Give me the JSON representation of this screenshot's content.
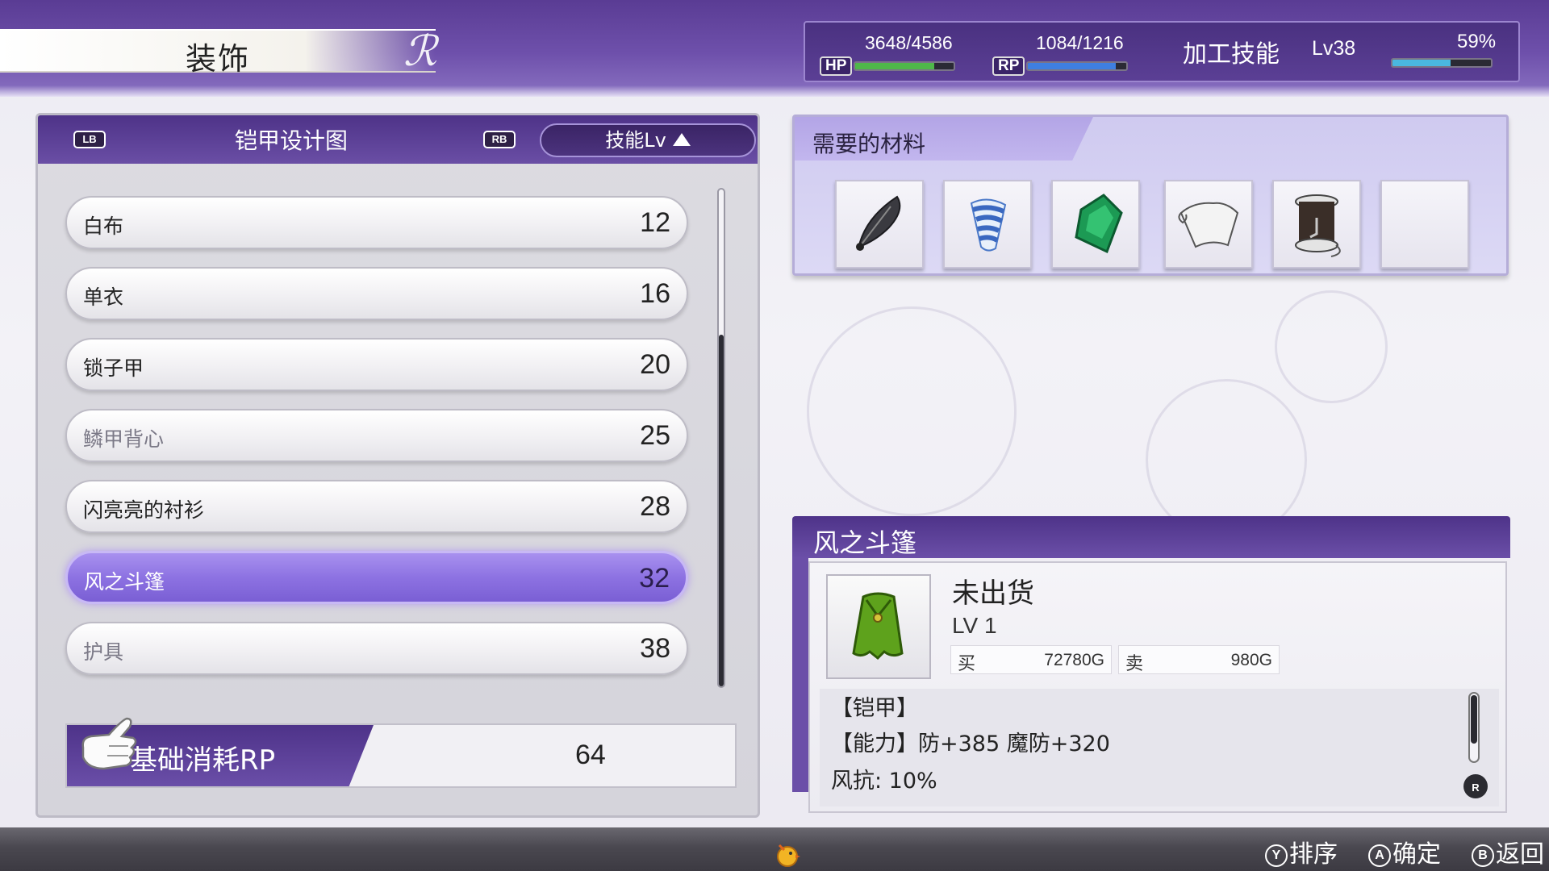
{
  "header": {
    "title": "装饰",
    "hp": {
      "tag": "HP",
      "value": "3648/4586",
      "ratio": 0.8
    },
    "rp": {
      "tag": "RP",
      "value": "1084/1216",
      "ratio": 0.89
    },
    "skill_label": "加工技能",
    "skill_level": "Lv38",
    "skill_percent": "59%",
    "skill_progress": 0.59
  },
  "recipe_panel": {
    "lb": "LB",
    "rb": "RB",
    "title": "铠甲设计图",
    "sort_label": "技能Lv",
    "items": [
      {
        "name": "白布",
        "lv": "12"
      },
      {
        "name": "单衣",
        "lv": "16"
      },
      {
        "name": "锁子甲",
        "lv": "20"
      },
      {
        "name": "鳞甲背心",
        "lv": "25"
      },
      {
        "name": "闪亮亮的衬衫",
        "lv": "28"
      },
      {
        "name": "风之斗篷",
        "lv": "32"
      },
      {
        "name": "护具",
        "lv": "38"
      }
    ],
    "selected_index": 5,
    "base_rp_label": "基础消耗RP",
    "base_rp_value": "64"
  },
  "materials": {
    "title": "需要的材料",
    "slots": [
      "feather-icon",
      "spiral-shell-icon",
      "emerald-icon",
      "cloth-scroll-icon",
      "thread-spool-icon",
      "empty-slot"
    ]
  },
  "detail": {
    "name": "风之斗篷",
    "icon": "green-cloak-icon",
    "status": "未出货",
    "level": "LV 1",
    "buy_label": "买",
    "buy_price": "72780G",
    "sell_label": "卖",
    "sell_price": "980G",
    "category": "【铠甲】",
    "ability": "【能力】防+385 魔防+320",
    "resist": "风抗: 10%",
    "r_button": "R"
  },
  "footer": {
    "sort": {
      "button": "Y",
      "label": "排序"
    },
    "confirm": {
      "button": "A",
      "label": "确定"
    },
    "back": {
      "button": "B",
      "label": "返回"
    }
  },
  "colors": {
    "accent": "#5a3c94",
    "selected": "#8d72e2",
    "hp": "#4fb84a",
    "rp": "#3f7fe0",
    "skill": "#4ab8e0"
  }
}
